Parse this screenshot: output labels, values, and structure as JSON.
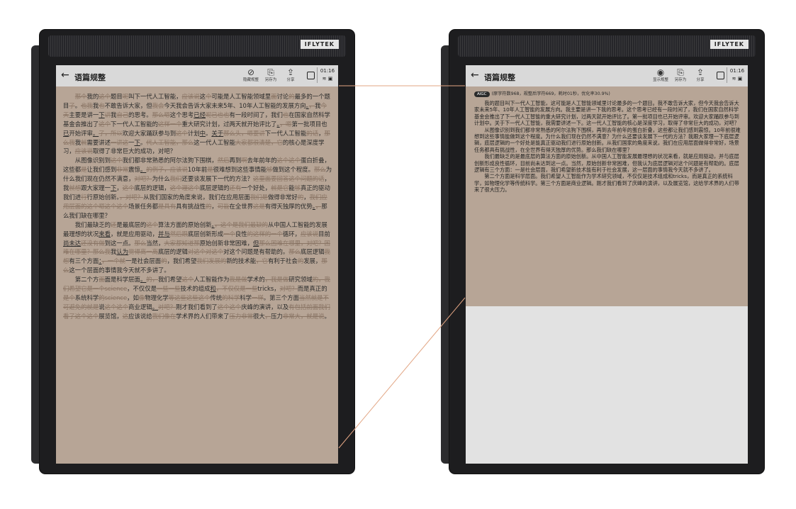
{
  "devices": {
    "brand": "IFLYTEK",
    "left": {
      "title": "语篇规整",
      "toolbar": [
        {
          "icon": "eye-off-icon",
          "glyph": "⊘",
          "label": "隐藏规整"
        },
        {
          "icon": "save-as-icon",
          "glyph": "⎘",
          "label": "另存为"
        },
        {
          "icon": "share-icon",
          "glyph": "⇪",
          "label": "分享"
        }
      ],
      "time": "01:16",
      "status_icons": "≋ ▣"
    },
    "right": {
      "title": "语篇规整",
      "toolbar": [
        {
          "icon": "eye-icon",
          "glyph": "◉",
          "label": "显示规整"
        },
        {
          "icon": "save-as-icon",
          "glyph": "⎘",
          "label": "另存为"
        },
        {
          "icon": "share-icon",
          "glyph": "⇪",
          "label": "分享"
        }
      ],
      "time": "01:16",
      "status_icons": "≋ ▣"
    }
  },
  "right_info": {
    "tag": "AIGC",
    "stats": "(原字符数968，规整后字符669，耗时01秒，优化率30.9%)"
  },
  "right_paragraphs": [
    "我的题目叫下一代人工智能，这可能是人工智能领域里讨论最多的一个题目。我不敢告诉大家，但今天我会告诉大家未来5年、10年人工智能的发展方向。我主要是讲一下我的思考。这个思考已经有一段时间了，我们在国家自然科学基金会推出了下一代人工智能的重大研究计划，过两天就开始评比了。第一批项目也已开始评审。欢迎大家踊跃参与到计划中。关于下一代人工智能，我需要讲述一下。这一代人工智能的核心是深度学习，取得了非常巨大的成功，对吧？",
    "从图像识别到我们都非常熟悉的阿尔法狗下围棋，再到去年前年的蛋白折叠，这些都让我们感到震惊。10年前很难想到这些事情能做到这个程度。为什么我们现在仍然不满意？为什么还要谈发展下一代的方法？我跟大家理一下底层逻辑，底层逻辑的一个好处是能真正驱动我们进行原始创新。从我们国家的角度来说，我们在应用层面做得非常好，场景任务都具有挑战性，在全世界有得天独厚的优势。那么我们缺在哪里？",
    "我们最缺乏的是最底层的算法方面的原始创新。从中国人工智能发展最理想的状况来看，就是应用驱动，并与底层创新形成良性循环，目前尚未达到这一点。当然，原始创新非常困难，但我认为底层逻辑对这个问题是有帮助的。底层逻辑有三个方面：一是社会层面，我们希望新技术能有利于社会发展，这一层面的事情我今天就不多讲了。",
    "第二个方面是科学层面。我们希望人工智能作为学术研究领域，不仅仅是技术组成和tricks，而是真正的系统科学，如物理化学等传统科学。第三个方面是商业逻辑。刚才我们看到了庆峰的演讲，以及展览馆，这给学术界的人们带来了很大压力。"
  ]
}
